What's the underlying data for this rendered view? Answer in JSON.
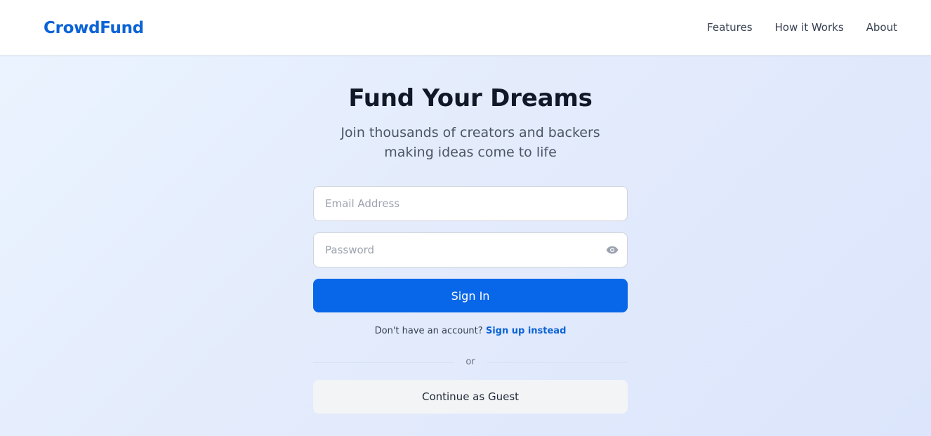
{
  "header": {
    "logo": "CrowdFund",
    "nav": [
      {
        "label": "Features"
      },
      {
        "label": "How it Works"
      },
      {
        "label": "About"
      }
    ]
  },
  "hero": {
    "title": "Fund Your Dreams",
    "subtitle": "Join thousands of creators and backers making ideas come to life"
  },
  "form": {
    "email": {
      "placeholder": "Email Address",
      "value": ""
    },
    "password": {
      "placeholder": "Password",
      "value": "",
      "toggle_icon": "eye-icon"
    },
    "signin_label": "Sign In",
    "no_account_text": "Don't have an account?",
    "signup_link": "Sign up instead",
    "divider_text": "or",
    "guest_label": "Continue as Guest"
  },
  "colors": {
    "brand": "#0b63d6",
    "primary_button": "#0866e8",
    "guest_button": "#f3f4f6"
  }
}
